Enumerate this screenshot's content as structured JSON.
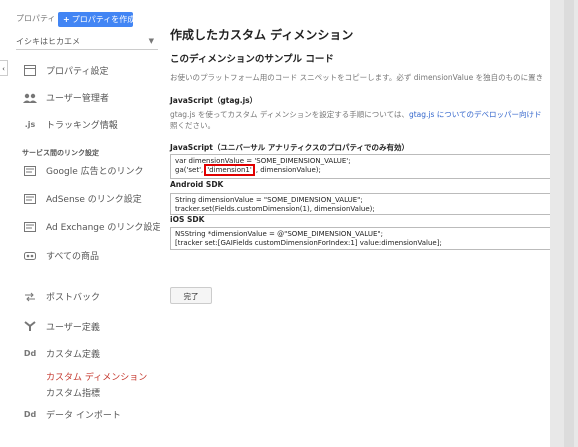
{
  "sidebar": {
    "property_label": "プロパティ",
    "create_property": "プロパティを作成",
    "property_select": "イシキはヒカエメ",
    "left_tab": "‹",
    "items": [
      {
        "label": "プロパティ設定",
        "icon": "property-settings-icon"
      },
      {
        "label": "ユーザー管理者",
        "icon": "users-icon"
      },
      {
        "label": "トラッキング情報",
        "icon": "js-icon"
      }
    ],
    "section_header": "サービス間のリンク設定",
    "link_items": [
      {
        "label": "Google 広告とのリンク",
        "icon": "ads-icon"
      },
      {
        "label": "AdSense のリンク設定",
        "icon": "adsense-icon"
      },
      {
        "label": "Ad Exchange のリンク設定",
        "icon": "ad-exchange-icon"
      },
      {
        "label": "すべての商品",
        "icon": "all-products-icon"
      }
    ],
    "other_items": [
      {
        "label": "ポストバック",
        "icon": "postback-icon"
      },
      {
        "label": "ユーザー定義",
        "icon": "user-defined-icon"
      },
      {
        "label": "カスタム定義",
        "icon": "dd-icon"
      }
    ],
    "sub_items": [
      "カスタム ディメンション",
      "カスタム指標"
    ],
    "data_import": "データ インポート",
    "js_glyph": ".js",
    "dd_glyph": "Dd"
  },
  "main": {
    "title": "作成したカスタム ディメンション",
    "subtitle": "このディメンションのサンプル コード",
    "description": "お使いのプラットフォーム用のコード スニペットをコピーします。必ず dimensionValue を独自のものに置き",
    "gtag_heading": "JavaScript（gtag.js）",
    "gtag_desc_prefix": "gtag.js を使ってカスタム ディメンションを設定する手順については、",
    "gtag_desc_link": "gtag.js についてのデベロッパー向けド",
    "gtag_desc_suffix": "照ください。",
    "js_heading": "JavaScript（ユニバーサル アナリティクスのプロパティでのみ有効）",
    "js_code_line1": "var dimensionValue = 'SOME_DIMENSION_VALUE';",
    "js_code_line2_a": "ga('set',",
    "js_code_line2_hl": "'dimension1'",
    "js_code_line2_b": ", dimensionValue);",
    "android_heading": "Android SDK",
    "android_line1": "String dimensionValue = \"SOME_DIMENSION_VALUE\";",
    "android_line2": "tracker.set(Fields.customDimension(1), dimensionValue);",
    "ios_heading": "iOS SDK",
    "ios_line1": "NSString *dimensionValue = @\"SOME_DIMENSION_VALUE\";",
    "ios_line2": "[tracker set:[GAIFields customDimensionForIndex:1] value:dimensionValue];",
    "done_button": "完了"
  }
}
